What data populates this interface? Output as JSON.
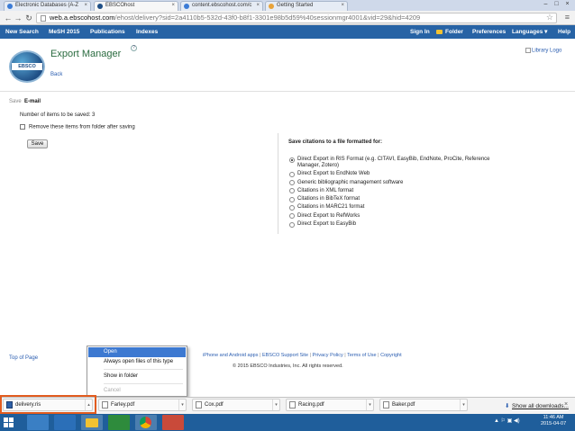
{
  "browser": {
    "tabs": [
      {
        "label": "Electronic Databases (A-Z",
        "active": false
      },
      {
        "label": "EBSCOhost",
        "active": true
      },
      {
        "label": "content.ebscohost.com/c",
        "active": false
      },
      {
        "label": "Getting Started",
        "active": false
      }
    ],
    "url_host": "web.a.ebscohost.com",
    "url_path": "/ehost/delivery?sid=2a4110b5-532d-43f0-b8f1-3301e98b5d59%40sessionmgr4001&vid=29&hid=4209"
  },
  "topnav": {
    "left": [
      "New Search",
      "MeSH 2015",
      "Publications",
      "Indexes"
    ],
    "sign_in": "Sign In",
    "folder": "Folder",
    "preferences": "Preferences",
    "languages": "Languages",
    "help": "Help"
  },
  "header": {
    "logo_text": "EBSCO",
    "title": "Export Manager",
    "help_badge": "?",
    "back": "Back",
    "library_logo": "Library Logo"
  },
  "subtabs": {
    "save": "Save",
    "email": "E-mail"
  },
  "left_panel": {
    "items_count": "Number of items to be saved: 3",
    "remove_checkbox": "Remove these items from folder after saving",
    "save_button": "Save"
  },
  "formats": {
    "heading": "Save citations to a file formatted for:",
    "options": [
      {
        "label": "Direct Export in RIS Format (e.g. CITAVI, EasyBib, EndNote, ProCite, Reference Manager, Zotero)",
        "selected": true
      },
      {
        "label": "Direct Export to EndNote Web",
        "selected": false
      },
      {
        "label": "Generic bibliographic management software",
        "selected": false
      },
      {
        "label": "Citations in XML format",
        "selected": false
      },
      {
        "label": "Citations in BibTeX format",
        "selected": false
      },
      {
        "label": "Citations in MARC21 format",
        "selected": false
      },
      {
        "label": "Direct Export to RefWorks",
        "selected": false
      },
      {
        "label": "Direct Export to EasyBib",
        "selected": false
      }
    ]
  },
  "footer": {
    "top_of_page": "Top of Page",
    "links": [
      "iPhone and Android apps",
      "EBSCO Support Site",
      "Privacy Policy",
      "Terms of Use",
      "Copyright"
    ],
    "copyright": "© 2015 EBSCO Industries, Inc. All rights reserved."
  },
  "context_menu": {
    "items": [
      "Open",
      "Always open files of this type",
      "Show in folder",
      "Cancel"
    ]
  },
  "downloads": {
    "items": [
      "delivery.ris",
      "Farley.pdf",
      "Cox.pdf",
      "Racing.pdf",
      "Baker.pdf"
    ],
    "show_all": "Show all downloads..."
  },
  "taskbar": {
    "time": "11:46 AM",
    "date": "2015-04-07"
  },
  "colors": {
    "nav_blue": "#2763a5",
    "title_green": "#2a6b3f",
    "menu_highlight": "#3d79d1",
    "callout_orange": "#e25c1f",
    "taskbar_blue": "#1f5e9b"
  }
}
